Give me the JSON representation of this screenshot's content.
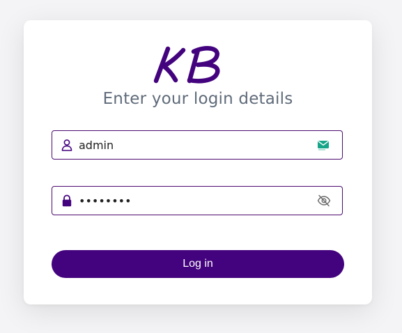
{
  "brand": {
    "logo_text": "KB",
    "logo_color": "#44037e"
  },
  "login": {
    "title": "Enter your login details",
    "username": {
      "value": "admin",
      "left_icon": "user-icon",
      "right_icon": "email-badge-icon"
    },
    "password": {
      "value": "12345678",
      "left_icon": "lock-icon",
      "right_icon": "eye-off-icon"
    },
    "submit_label": "Log in"
  },
  "colors": {
    "accent": "#44037e",
    "field_border": "#4a0a6e",
    "title_text": "#5f6b7a",
    "card_background": "#ffffff",
    "page_background": "#f4f4f6"
  }
}
